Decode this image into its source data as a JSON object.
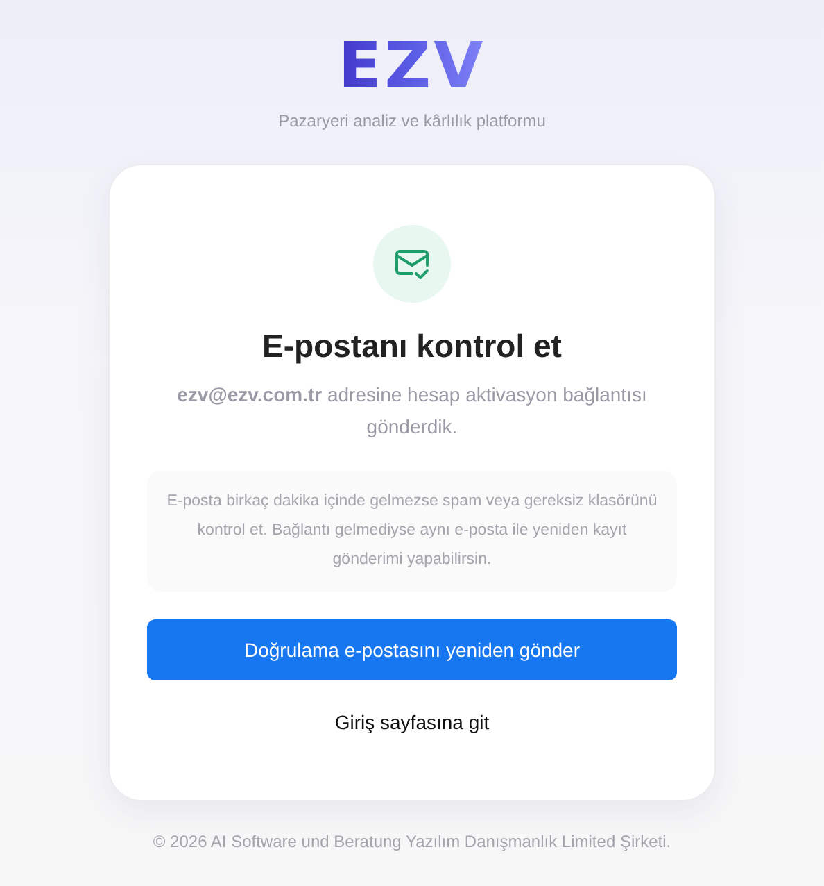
{
  "brand": {
    "logo": "EZV",
    "tagline": "Pazaryeri analiz ve kârlılık platformu"
  },
  "card": {
    "title": "E-postanı kontrol et",
    "message": "**ezv@ezv.com.tr** adresine hesap aktivasyon bağlantısı gönderdik.",
    "notice": "E-posta birkaç dakika içinde gelmezse spam veya gereksiz klasörünü kontrol et. Bağlantı gelmediyse aynı e-posta ile yeniden kayıt gönderimi yapabilirsin.",
    "primary_button": "Doğrulama e-postasını yeniden gönder",
    "link": "Giriş sayfasına git"
  },
  "footer": "© 2026 AI Software und Beratung Yazılım Danışmanlık Limited Şirketi."
}
